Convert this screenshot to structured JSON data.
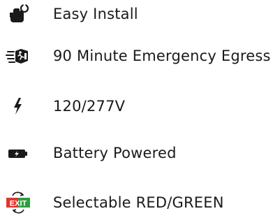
{
  "features": [
    {
      "icon": "hand-wrench-icon",
      "label": "Easy Install"
    },
    {
      "icon": "running-person-exit-icon",
      "label": "90 Minute Emergency Egress"
    },
    {
      "icon": "lightning-bolt-icon",
      "label": "120/277V"
    },
    {
      "icon": "battery-charging-icon",
      "label": "Battery Powered"
    },
    {
      "icon": "exit-sign-red-green-icon",
      "label": "Selectable RED/GREEN",
      "exit_text": "EXIT"
    }
  ],
  "colors": {
    "text": "#1a1a1a",
    "exit_red": "#e3342f",
    "exit_green": "#2e9e3e"
  }
}
